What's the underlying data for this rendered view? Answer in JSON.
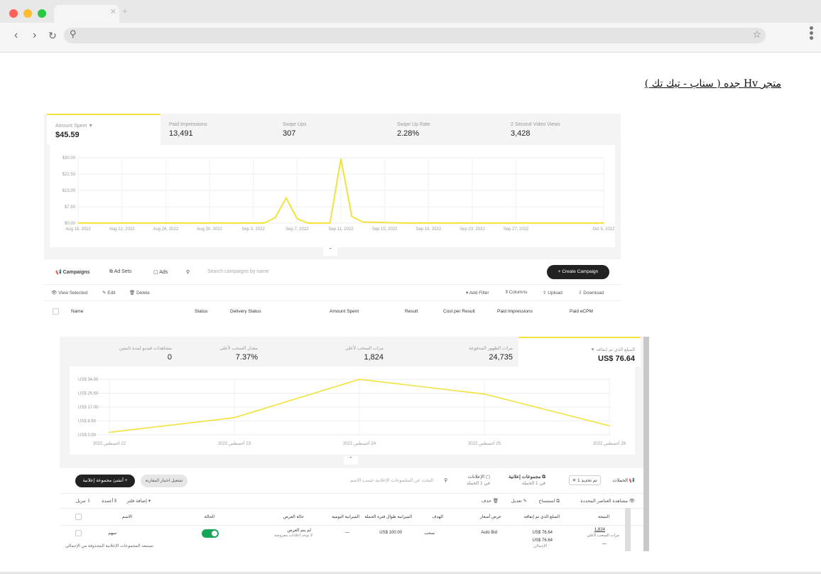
{
  "browser": {
    "search_icon": "search-icon",
    "star_icon": "star-icon"
  },
  "heading": "متجر Hv جده ( سناب - تيك تك )",
  "p1": {
    "metrics": [
      {
        "label": "Amount Spent ▼",
        "value": "$45.59"
      },
      {
        "label": "Paid Impressions",
        "value": "13,491"
      },
      {
        "label": "Swipe Ups",
        "value": "307"
      },
      {
        "label": "Swipe Up Rate",
        "value": "2.28%"
      },
      {
        "label": "2 Second Video Views",
        "value": "3,428"
      }
    ],
    "tabs": {
      "campaigns": "Campaigns",
      "adsets": "Ad Sets",
      "ads": "Ads"
    },
    "search_placeholder": "Search campaigns by name",
    "create": "+ Create Campaign",
    "actions": {
      "view": "View Selected",
      "edit": "Edit",
      "delete": "Delete",
      "filter": "Add Filter",
      "columns": "Columns",
      "upload": "Upload",
      "download": "Download"
    },
    "columns": [
      "Name",
      "Status",
      "Delivery Status",
      "Amount Spent",
      "Result",
      "Cost per Result",
      "Paid Impressions",
      "Paid eCPM"
    ]
  },
  "p2": {
    "metrics": [
      {
        "label": "المبلغ الذي تم إنفاقه ▼",
        "value": "US$ 76.64"
      },
      {
        "label": "مرات الظهور المدفوعة",
        "value": "24,735"
      },
      {
        "label": "مرات السحب لأعلى",
        "value": "1,824"
      },
      {
        "label": "معدل السحب لأعلى",
        "value": "7.37%"
      },
      {
        "label": "مشاهدات فيديو لمدة ثانيتين",
        "value": "0"
      }
    ],
    "tabs": {
      "campaigns": "الحملات",
      "filter_chip": "تم تحديد 1",
      "adsets": "مجموعات إعلانية",
      "adsets_sub": "في 1 الحملة",
      "ads": "الإعلانات",
      "ads_sub": "في 1 الحملة"
    },
    "search_placeholder": "البحث عن المجموعات الإعلانية حسب الاسم",
    "create": "+ أنشئ مجموعة إعلانية",
    "compare": "تشغيل اختبار المقارنة",
    "actions": {
      "view": "مشاهدة العناصر المحددة",
      "duplicate": "استنساخ",
      "edit": "تعديل",
      "delete": "حذف",
      "filter": "إضافة فلتر",
      "columns": "أعمدة",
      "download": "تنزيل"
    },
    "columns": [
      "النتيجة",
      "المبلغ الذي تم إنفاقه",
      "عرض أسعار",
      "الهدف",
      "الميزانية طوال فترة الحملة",
      "الميزانية اليومية",
      "حالة العرض",
      "الحالة",
      "الاسم"
    ],
    "row": {
      "result": "1,824",
      "result_sub": "مرات السحب لأعلى",
      "spent": "US$ 76.64",
      "bid": "Auto Bid",
      "goal": "سحب",
      "lifetime": "US$ 100.00",
      "daily": "—",
      "delivery": "لم يتم العرض",
      "delivery_sub": "لا توجد إعلانات معروضة",
      "name": "سهم"
    },
    "total": {
      "note": "تستبعد المجموعات الإعلانية المحذوفة من الإجمالي",
      "spent": "US$ 76.64",
      "spent_sub": "الإجمالي",
      "result": "—"
    }
  },
  "chart_data": [
    {
      "type": "line",
      "title": "",
      "xlabel": "",
      "ylabel": "",
      "x_ticks": [
        "Aug 18, 2022",
        "Aug 22, 2022",
        "Aug 26, 2022",
        "Aug 30, 2022",
        "Sep 3, 2022",
        "Sep 7, 2022",
        "Sep 11, 2022",
        "Sep 15, 2022",
        "Sep 19, 2022",
        "Sep 23, 2022",
        "Sep 27, 2022",
        "Oct 5, 2022"
      ],
      "y_ticks": [
        "$0.00",
        "$7.50",
        "$15.00",
        "$22.50",
        "$30.00"
      ],
      "ylim": [
        0,
        30
      ],
      "x": [
        "2022-08-18",
        "2022-08-20",
        "2022-08-22",
        "2022-08-24",
        "2022-08-26",
        "2022-08-28",
        "2022-08-30",
        "2022-09-01",
        "2022-09-03",
        "2022-09-04",
        "2022-09-05",
        "2022-09-06",
        "2022-09-07",
        "2022-09-08",
        "2022-09-09",
        "2022-09-10",
        "2022-09-11",
        "2022-09-12",
        "2022-09-13",
        "2022-09-17",
        "2022-09-21",
        "2022-09-25",
        "2022-09-29",
        "2022-10-05"
      ],
      "series": [
        {
          "values": [
            0,
            0,
            0,
            0,
            0,
            0,
            0,
            0,
            0,
            0,
            2.5,
            11.5,
            2,
            0,
            0,
            0,
            29.5,
            3,
            0.5,
            0,
            0,
            0,
            0,
            0
          ]
        }
      ],
      "grid": true
    },
    {
      "type": "line",
      "title": "",
      "xlabel": "",
      "ylabel": "",
      "x_ticks": [
        "22 أغسطس 2022",
        "23 أغسطس 2022",
        "24 أغسطس 2022",
        "25 أغسطس 2022",
        "26 أغسطس 2022"
      ],
      "y_ticks": [
        "US$ 0.00",
        "US$ 8.50",
        "US$ 17.00",
        "US$ 25.50",
        "US$ 34.00"
      ],
      "ylim": [
        0,
        34
      ],
      "x": [
        "22 أغسطس 2022",
        "23 أغسطس 2022",
        "24 أغسطس 2022",
        "25 أغسطس 2022",
        "26 أغسطس 2022"
      ],
      "series": [
        {
          "values": [
            1.5,
            10.5,
            34.0,
            25.0,
            5.5
          ]
        }
      ],
      "grid": true
    }
  ]
}
